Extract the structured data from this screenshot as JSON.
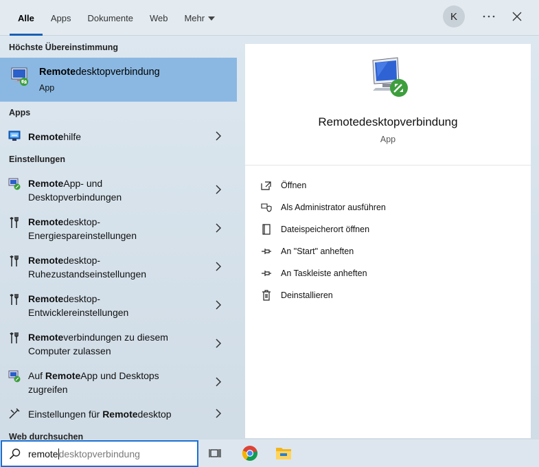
{
  "tabs": [
    {
      "label": "Alle",
      "active": true
    },
    {
      "label": "Apps"
    },
    {
      "label": "Dokumente"
    },
    {
      "label": "Web"
    },
    {
      "label": "Mehr",
      "dropdown": true
    }
  ],
  "header": {
    "avatar_initial": "K",
    "more_icon": "more-icon",
    "close_icon": "close-icon"
  },
  "left": {
    "best_match_header": "Höchste Übereinstimmung",
    "best_match": {
      "title_bold": "Remote",
      "title_rest": "desktopverbindung",
      "subtitle": "App",
      "icon": "remote-desktop-icon"
    },
    "apps_header": "Apps",
    "apps": [
      {
        "bold": "Remote",
        "rest": "hilfe",
        "icon": "remote-assistance-icon"
      }
    ],
    "settings_header": "Einstellungen",
    "settings": [
      {
        "pre": "",
        "bold": "Remote",
        "rest": "App- und",
        "line2": "Desktopverbindungen",
        "icon": "remoteapp-icon"
      },
      {
        "pre": "",
        "bold": "Remote",
        "rest": "desktop-",
        "line2": "Energiespareinstellungen",
        "icon": "settings-tools-icon"
      },
      {
        "pre": "",
        "bold": "Remote",
        "rest": "desktop-",
        "line2": "Ruhezustandseinstellungen",
        "icon": "settings-tools-icon"
      },
      {
        "pre": "",
        "bold": "Remote",
        "rest": "desktop-",
        "line2": "Entwicklereinstellungen",
        "icon": "settings-tools-icon"
      },
      {
        "pre": "",
        "bold": "Remote",
        "rest": "verbindungen zu diesem",
        "line2": "Computer zulassen",
        "icon": "settings-tools-icon"
      },
      {
        "pre": "Auf ",
        "bold": "Remote",
        "rest": "App und Desktops",
        "line2": "zugreifen",
        "icon": "remoteapp-icon"
      },
      {
        "pre": "Einstellungen für ",
        "bold": "Remote",
        "rest": "desktop",
        "line2": "",
        "icon": "remote-desktop-settings-icon"
      }
    ],
    "web_header": "Web durchsuchen"
  },
  "right": {
    "app_name": "Remotedesktopverbindung",
    "app_type": "App",
    "actions": [
      {
        "label": "Öffnen",
        "icon": "open-icon"
      },
      {
        "label": "Als Administrator ausführen",
        "icon": "admin-shield-icon"
      },
      {
        "label": "Dateispeicherort öffnen",
        "icon": "file-location-icon"
      },
      {
        "label": "An \"Start\" anheften",
        "icon": "pin-icon"
      },
      {
        "label": "An Taskleiste anheften",
        "icon": "pin-icon"
      },
      {
        "label": "Deinstallieren",
        "icon": "trash-icon"
      }
    ]
  },
  "search": {
    "typed": "remote",
    "suggestion": "desktopverbindung"
  },
  "taskbar": {
    "icons": [
      "task-view-icon",
      "chrome-icon",
      "file-explorer-icon"
    ]
  },
  "colors": {
    "accent": "#1a5fb4",
    "highlight": "#8ab8e2",
    "search_border": "#1a6fd1"
  }
}
